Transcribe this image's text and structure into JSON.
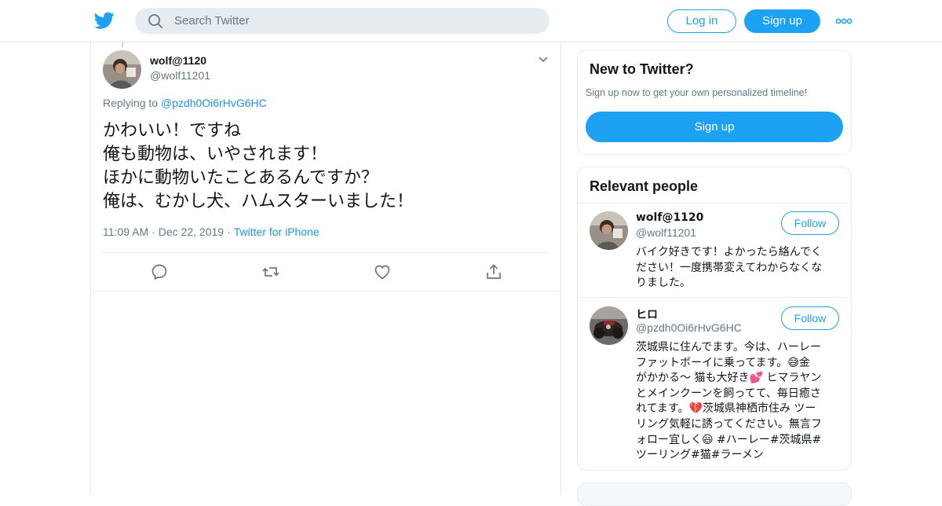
{
  "header": {
    "logo_icon": "twitter-bird-icon",
    "search_placeholder": "Search Twitter",
    "login_label": "Log in",
    "signup_label": "Sign up",
    "more_icon": "more-dots-icon",
    "brand_color": "#1da1f2"
  },
  "tweet": {
    "author_name": "wolf@1120",
    "author_handle": "@wolf11201",
    "replying_prefix": "Replying to",
    "replying_to": "@pzdh0Oi6rHvG6HC",
    "lines": [
      "かわいい！ですね",
      "俺も動物は、いやされます！",
      "ほかに動物いたことあるんですか？",
      "俺は、むかし犬、ハムスターいました！"
    ],
    "time": "11:09 AM",
    "date": "Dec 22, 2019",
    "source": "Twitter for iPhone",
    "actions": [
      "reply-icon",
      "retweet-icon",
      "like-icon",
      "share-icon"
    ]
  },
  "sidebar": {
    "new_to_twitter": {
      "title": "New to Twitter?",
      "subtitle": "Sign up now to get your own personalized timeline!",
      "button": "Sign up"
    },
    "relevant_people": {
      "title": "Relevant people",
      "people": [
        {
          "name": "wolf@1120",
          "handle": "@wolf11201",
          "follow_label": "Follow",
          "bio_lines": [
            "バイク好きです！よかったら絡んでく",
            "ださい！一度携帯変えてわからなくな",
            "りました。"
          ]
        },
        {
          "name": "ヒロ",
          "handle": "@pzdh0Oi6rHvG6HC",
          "follow_label": "Follow",
          "bio_lines": [
            "茨城県に住んでます。今は、ハーレー",
            "ファットボーイに乗ってます。😅金",
            "がかかる〜 猫も大好き💕 ヒマラヤン",
            "とメインクーンを飼ってて、毎日癒さ",
            "れてます。💔茨城県神栖市住み ツー",
            "リング気軽に誘ってください。無言フ",
            "ォロー宜しく😃 #ハーレー#茨城県#",
            "ツーリング#猫#ラーメン"
          ]
        }
      ]
    }
  }
}
